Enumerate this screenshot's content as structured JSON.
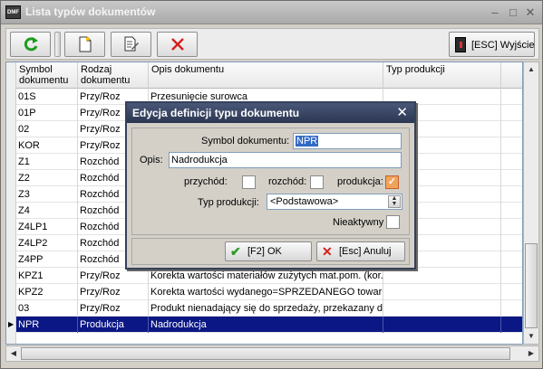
{
  "window": {
    "title": "Lista typów dokumentów",
    "app_icon_text": "DMF"
  },
  "toolbar": {
    "exit_label": "[ESC] Wyjście"
  },
  "grid": {
    "columns": [
      "Symbol dokumentu",
      "Rodzaj dokumentu",
      "Opis dokumentu",
      "Typ produkcji"
    ],
    "rows": [
      [
        "01S",
        "Przy/Roz",
        "Przesunięcie surowca",
        ""
      ],
      [
        "01P",
        "Przy/Roz",
        "",
        ""
      ],
      [
        "02",
        "Przy/Roz",
        "",
        ""
      ],
      [
        "KOR",
        "Przy/Roz",
        "",
        ""
      ],
      [
        "Z1",
        "Rozchód",
        "",
        ""
      ],
      [
        "Z2",
        "Rozchód",
        "",
        ""
      ],
      [
        "Z3",
        "Rozchód",
        "",
        ""
      ],
      [
        "Z4",
        "Rozchód",
        "",
        ""
      ],
      [
        "Z4LP1",
        "Rozchód",
        "",
        ""
      ],
      [
        "Z4LP2",
        "Rozchód",
        "",
        ""
      ],
      [
        "Z4PP",
        "Rozchód",
        "",
        ""
      ],
      [
        "KPZ1",
        "Przy/Roz",
        "Korekta wartości materiałów zużytych mat.pom. (kor. k",
        ""
      ],
      [
        "KPZ2",
        "Przy/Roz",
        "Korekta wartości wydanego=SPRZEDANEGO towaru",
        ""
      ],
      [
        "03",
        "Przy/Roz",
        "Produkt nienadający się do sprzedaży, przekazany do",
        ""
      ],
      [
        "NPR",
        "Produkcja",
        "Nadrodukcja",
        ""
      ]
    ],
    "selected_row": 14
  },
  "dialog": {
    "title": "Edycja definicji typu dokumentu",
    "symbol_label": "Symbol dokumentu:",
    "symbol_value": "NPR",
    "opis_label": "Opis:",
    "opis_value": "Nadrodukcja",
    "przychod_label": "przychód:",
    "rozchod_label": "rozchód:",
    "produkcja_label": "produkcja:",
    "typ_label": "Typ produkcji:",
    "typ_value": "<Podstawowa>",
    "nieaktywny_label": "Nieaktywny",
    "ok_label": "[F2] OK",
    "cancel_label": "[Esc] Anuluj"
  }
}
